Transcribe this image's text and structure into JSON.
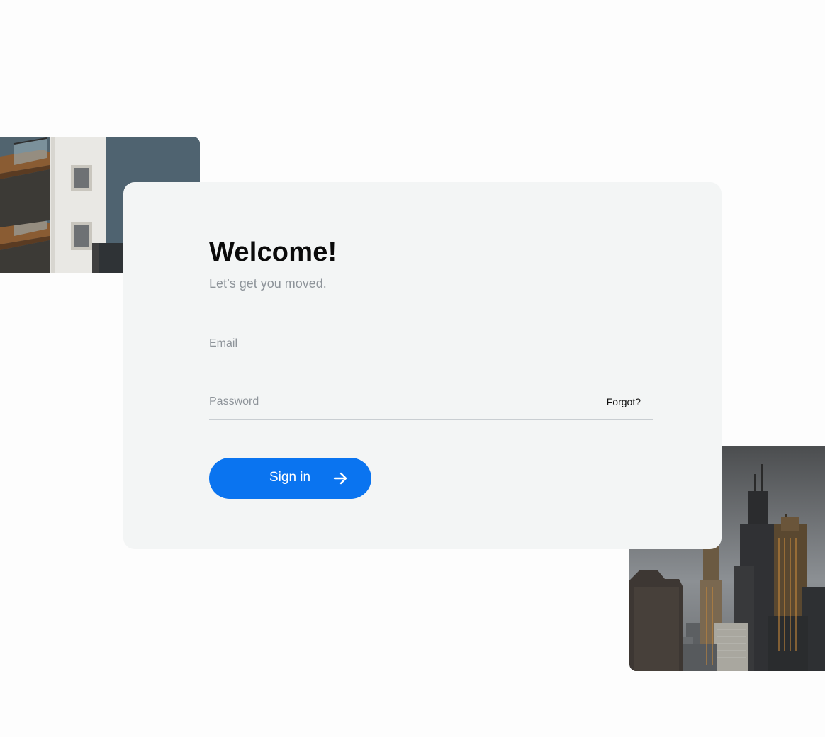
{
  "login": {
    "title": "Welcome!",
    "subtitle": "Let’s get you moved.",
    "email": {
      "placeholder": "Email",
      "value": ""
    },
    "password": {
      "placeholder": "Password",
      "value": "",
      "forgot_label": "Forgot?"
    },
    "signin_label": "Sign in"
  },
  "icons": {
    "signin_button": "arrow-right-icon"
  },
  "colors": {
    "accent": "#0a74f0",
    "card_background": "#f3f5f5",
    "page_background": "#fdfdfd",
    "muted_text": "#8e949a",
    "heading_text": "#0a0a0a"
  }
}
